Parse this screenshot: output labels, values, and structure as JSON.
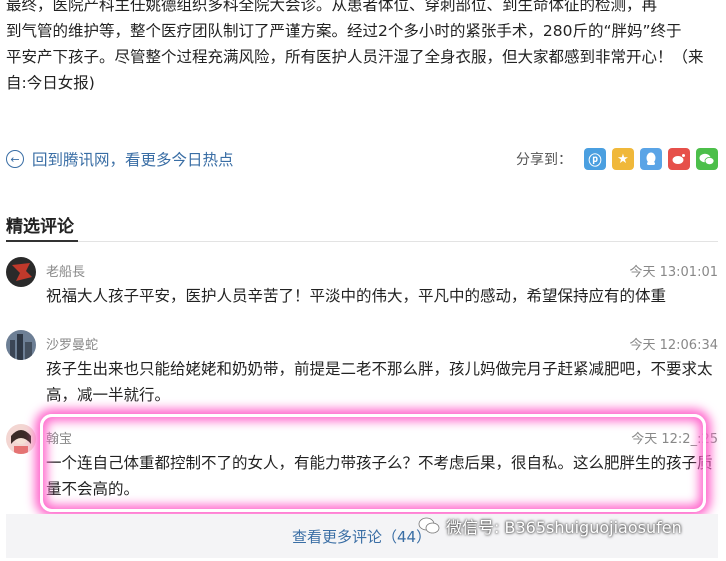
{
  "article": {
    "line1": "最终，医院产科主任姚德组织多科全院大会诊。从患者体位、穿刺部位、到生命体征的检测，再",
    "line2": "到气管的维护等，整个医疗团队制订了严谨方案。经过2个多小时的紧张手术，280斤的“胖妈”终于",
    "line3": "平安产下孩子。尽管整个过程充满风险，所有医护人员汗湿了全身衣服，但大家都感到非常开心！（来",
    "line4": "自:今日女报)"
  },
  "nav": {
    "back_label": "回到腾讯网，看更多今日热点",
    "share_label": "分享到：",
    "share_icons": [
      "qzone-icon",
      "favorite-icon",
      "qq-icon",
      "weibo-icon",
      "wechat-icon"
    ]
  },
  "section": {
    "title": "精选评论"
  },
  "comments": [
    {
      "name": "老船長",
      "time": "今天 13:01:01",
      "text": "祝福大人孩子平安，医护人员辛苦了！平淡中的伟大，平凡中的感动，希望保持应有的体重"
    },
    {
      "name": "沙罗曼蛇",
      "time": "今天 12:06:34",
      "text": "孩子生出来也只能给姥姥和奶奶带，前提是二老不那么胖，孩儿妈做完月子赶紧减肥吧，不要求太高，减一半就行。"
    },
    {
      "name": "翰宝",
      "time": "今天 12:2_:25",
      "text": "一个连自己体重都控制不了的女人，有能力带孩子么？不考虑后果，很自私。这么肥胖生的孩子质量不会高的。"
    }
  ],
  "footer": {
    "more_comments": "查看更多评论（44）",
    "watermark": "微信号: B365shuiguojiaosufen"
  },
  "colors": {
    "link": "#3a6ea5",
    "highlight": "#ff66cc",
    "qzone": "#4a9fe0",
    "favorite": "#f0b83a",
    "qq": "#5aa4e6",
    "weibo": "#e6504a",
    "wechat": "#4cbf4a"
  }
}
